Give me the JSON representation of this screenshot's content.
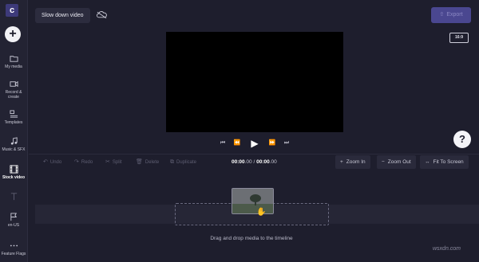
{
  "app": {
    "logo_letter": "c"
  },
  "header": {
    "project_title": "Slow down video",
    "export_label": "Export"
  },
  "sidebar": {
    "items": [
      {
        "label": "My media",
        "icon": "folder-icon"
      },
      {
        "label": "Record & create",
        "icon": "camera-icon"
      },
      {
        "label": "Templates",
        "icon": "templates-icon"
      },
      {
        "label": "Music & SFX",
        "icon": "music-icon"
      },
      {
        "label": "Stock video",
        "icon": "film-icon"
      },
      {
        "label": "",
        "icon": "text-icon"
      },
      {
        "label": "en-US",
        "icon": "flag-icon"
      },
      {
        "label": "Feature Flags",
        "icon": "more-icon"
      }
    ]
  },
  "preview": {
    "aspect_ratio": "16:9"
  },
  "toolbar": {
    "undo": "Undo",
    "redo": "Redo",
    "split": "Split",
    "delete": "Delete",
    "duplicate": "Duplicate",
    "time_current": "00:00",
    "time_current_frac": ".00",
    "time_sep": " / ",
    "time_total": "00:00",
    "time_total_frac": ".00",
    "zoom_in": "Zoom In",
    "zoom_out": "Zoom Out",
    "fit": "Fit To Screen"
  },
  "timeline": {
    "drop_text": "Drag and drop media to the timeline"
  },
  "help": {
    "label": "?"
  },
  "watermark": "wsxdn.com",
  "colors": {
    "background": "#1e1e2d",
    "accent": "#4a4790",
    "sidebar": "#232333"
  }
}
